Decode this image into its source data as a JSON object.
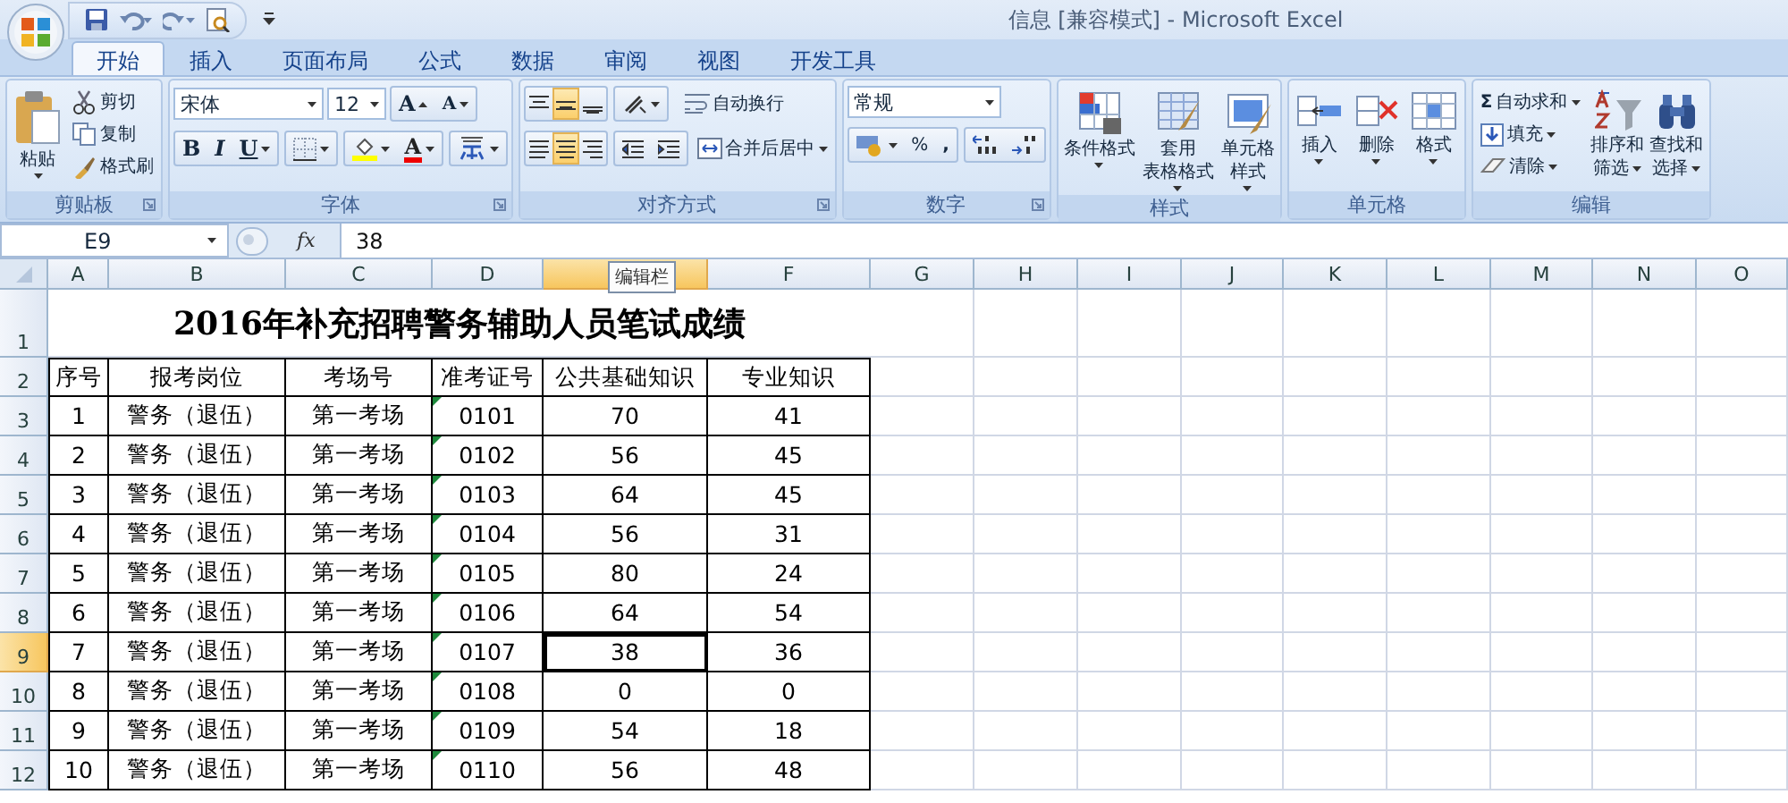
{
  "window": {
    "title": "信息  [兼容模式] - Microsoft Excel"
  },
  "tabs": [
    {
      "label": "开始",
      "selected": true
    },
    {
      "label": "插入",
      "selected": false
    },
    {
      "label": "页面布局",
      "selected": false
    },
    {
      "label": "公式",
      "selected": false
    },
    {
      "label": "数据",
      "selected": false
    },
    {
      "label": "审阅",
      "selected": false
    },
    {
      "label": "视图",
      "selected": false
    },
    {
      "label": "开发工具",
      "selected": false
    }
  ],
  "ribbon": [
    {
      "kind": "clipboard",
      "label": "剪贴板",
      "paste": "粘贴",
      "actions": [
        "剪切",
        "复制",
        "格式刷"
      ]
    },
    {
      "kind": "font",
      "label": "字体",
      "font": "宋体",
      "size": "12",
      "grow": "A",
      "shrink": "A",
      "bold": "B",
      "italic": "I",
      "underline": "U",
      "font_color": "A"
    },
    {
      "kind": "alignment",
      "label": "对齐方式",
      "valign": [
        {
          "selected": false
        },
        {
          "selected": true
        },
        {
          "selected": false
        }
      ],
      "halign": [
        {
          "selected": false
        },
        {
          "selected": true
        },
        {
          "selected": false
        }
      ],
      "wrap": "自动换行",
      "merge": "合并后居中"
    },
    {
      "kind": "number",
      "label": "数字",
      "format": "常规",
      "percent": "%",
      "comma": ","
    },
    {
      "kind": "styles",
      "label": "样式",
      "buttons": [
        {
          "lines": [
            "条件格式"
          ]
        },
        {
          "lines": [
            "套用",
            "表格格式"
          ]
        },
        {
          "lines": [
            "单元格",
            "样式"
          ]
        }
      ]
    },
    {
      "kind": "cells",
      "label": "单元格",
      "buttons": [
        {
          "lines": [
            "插入"
          ]
        },
        {
          "lines": [
            "删除"
          ]
        },
        {
          "lines": [
            "格式"
          ]
        }
      ]
    },
    {
      "kind": "editing",
      "label": "编辑",
      "sum_sign": "Σ",
      "actions": [
        "自动求和",
        "填充",
        "清除"
      ],
      "buttons": [
        {
          "lines": [
            "排序和",
            "筛选"
          ]
        },
        {
          "lines": [
            "查找和",
            "选择"
          ]
        }
      ]
    }
  ],
  "formula_bar": {
    "name_box": "E9",
    "function_label": "fx",
    "formula": "38",
    "tooltip": "编辑栏"
  },
  "sheet": {
    "columns": [
      {
        "label": "A",
        "selected": false
      },
      {
        "label": "B",
        "selected": false
      },
      {
        "label": "C",
        "selected": false
      },
      {
        "label": "D",
        "selected": false
      },
      {
        "selected": true
      },
      {
        "label": "F",
        "selected": false
      },
      {
        "label": "G",
        "selected": false
      },
      {
        "label": "H",
        "selected": false
      },
      {
        "label": "I",
        "selected": false
      },
      {
        "label": "J",
        "selected": false
      },
      {
        "label": "K",
        "selected": false
      },
      {
        "label": "L",
        "selected": false
      },
      {
        "label": "M",
        "selected": false
      },
      {
        "label": "N",
        "selected": false
      },
      {
        "label": "O",
        "selected": false
      }
    ],
    "rows": [
      {
        "number": "1",
        "selected": false,
        "kind": "title",
        "title": "2016年补充招聘警务辅助人员笔试成绩"
      },
      {
        "number": "2",
        "selected": false,
        "kind": "header",
        "cells": [
          "序号",
          "报考岗位",
          "考场号",
          "准考证号",
          "公共基础知识",
          "专业知识"
        ]
      },
      {
        "number": "3",
        "selected": false,
        "kind": "data",
        "cells": [
          "1",
          "警务（退伍）",
          "第一考场",
          "0101",
          "70",
          "41"
        ]
      },
      {
        "number": "4",
        "selected": false,
        "kind": "data",
        "cells": [
          "2",
          "警务（退伍）",
          "第一考场",
          "0102",
          "56",
          "45"
        ]
      },
      {
        "number": "5",
        "selected": false,
        "kind": "data",
        "cells": [
          "3",
          "警务（退伍）",
          "第一考场",
          "0103",
          "64",
          "45"
        ]
      },
      {
        "number": "6",
        "selected": false,
        "kind": "data",
        "cells": [
          "4",
          "警务（退伍）",
          "第一考场",
          "0104",
          "56",
          "31"
        ]
      },
      {
        "number": "7",
        "selected": false,
        "kind": "data",
        "cells": [
          "5",
          "警务（退伍）",
          "第一考场",
          "0105",
          "80",
          "24"
        ]
      },
      {
        "number": "8",
        "selected": false,
        "kind": "data",
        "cells": [
          "6",
          "警务（退伍）",
          "第一考场",
          "0106",
          "64",
          "54"
        ]
      },
      {
        "number": "9",
        "selected": true,
        "kind": "data",
        "cells": [
          "7",
          "警务（退伍）",
          "第一考场",
          "0107",
          "38",
          "36"
        ]
      },
      {
        "number": "10",
        "selected": false,
        "kind": "data",
        "cells": [
          "8",
          "警务（退伍）",
          "第一考场",
          "0108",
          "0",
          "0"
        ]
      },
      {
        "number": "11",
        "selected": false,
        "kind": "data",
        "cells": [
          "9",
          "警务（退伍）",
          "第一考场",
          "0109",
          "54",
          "18"
        ]
      },
      {
        "number": "12",
        "selected": false,
        "kind": "data",
        "cells": [
          "10",
          "警务（退伍）",
          "第一考场",
          "0110",
          "56",
          "48"
        ]
      }
    ]
  }
}
